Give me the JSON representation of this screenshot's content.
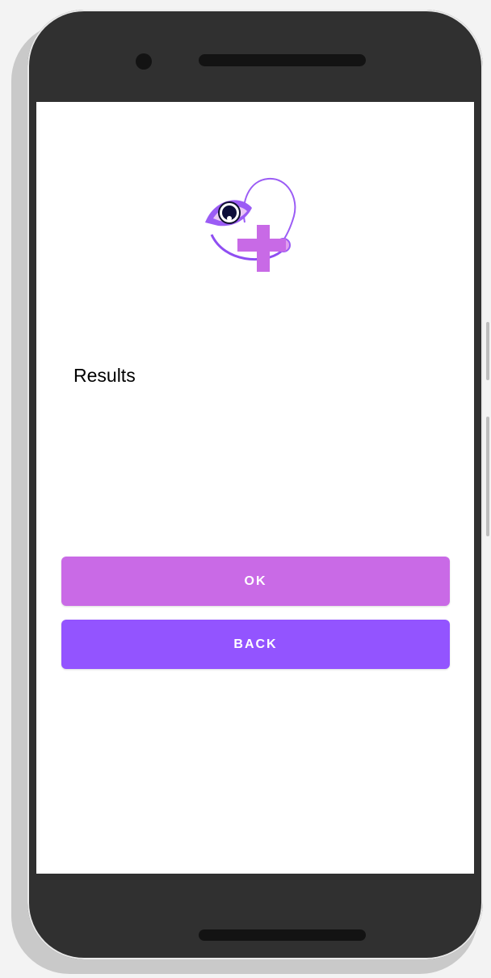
{
  "screen": {
    "logo_icon": "eye-plus-stethoscope-logo-icon",
    "results_label": "Results"
  },
  "buttons": {
    "ok_label": "OK",
    "back_label": "BACK"
  },
  "colors": {
    "ok_button": "#c96ae6",
    "back_button": "#9354ff",
    "logo_purple": "#9b5cf5",
    "logo_pink": "#c86ae6",
    "phone_frame": "#303030"
  }
}
